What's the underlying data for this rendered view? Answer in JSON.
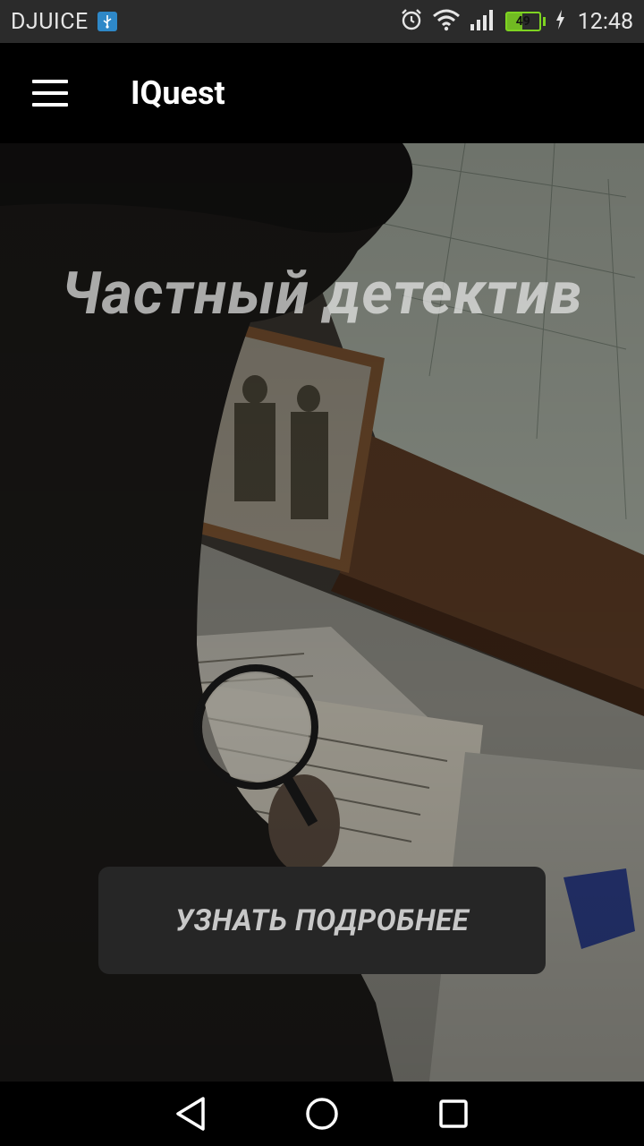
{
  "status_bar": {
    "carrier": "DJUICE",
    "time": "12:48",
    "battery_level": "49",
    "icons": [
      "usb-icon",
      "alarm-icon",
      "wifi-icon",
      "signal-icon",
      "battery-icon",
      "charging-icon"
    ]
  },
  "app_bar": {
    "title": "IQuest",
    "menu_icon": "hamburger-menu-icon"
  },
  "hero": {
    "title": "Частный детектив",
    "image": "detective-with-magnifying-glass-photo"
  },
  "cta": {
    "label": "УЗНАТЬ ПОДРОБНЕЕ"
  },
  "nav_bar": {
    "icons": [
      "back-icon",
      "home-icon",
      "recents-icon"
    ]
  },
  "colors": {
    "status_bar_bg": "#2b2b2b",
    "app_bar_bg": "#000000",
    "battery_green": "#7ed321",
    "usb_blue": "#2e88c8",
    "cta_bg": "#262626"
  }
}
